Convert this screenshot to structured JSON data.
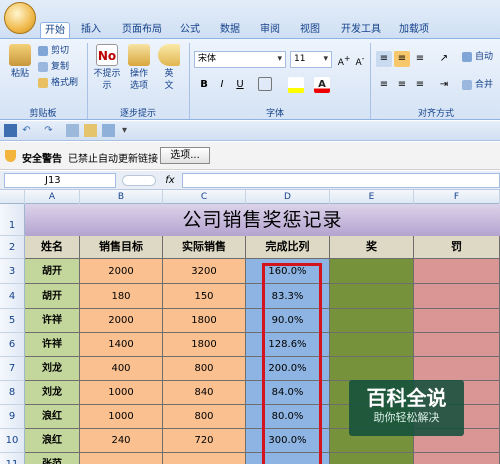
{
  "tabs": [
    "开始",
    "插入",
    "页面布局",
    "公式",
    "数据",
    "审阅",
    "视图",
    "开发工具",
    "加载项"
  ],
  "ribbon": {
    "clipboard": {
      "paste": "粘贴",
      "cut": "剪切",
      "copy": "复制",
      "format_painter": "格式刷",
      "label": "剪贴板"
    },
    "tips": {
      "no_tip": "不提示",
      "no_tip2": "示",
      "ops": "操作",
      "ops2": "选项",
      "en": "英",
      "en2": "文",
      "label": "逐步提示"
    },
    "font": {
      "name": "宋体",
      "size": "11",
      "label": "字体",
      "bold": "B",
      "italic": "I",
      "underline": "U"
    },
    "align": {
      "label": "对齐方式",
      "wrap": "自动",
      "merge": "合并"
    }
  },
  "qat": {
    "items": [
      "save-icon",
      "undo-icon",
      "redo-icon",
      "print-preview-icon",
      "email-icon",
      "customize-icon"
    ]
  },
  "msgbar": {
    "warning": "安全警告",
    "text": "已禁止自动更新链接",
    "button": "选项..."
  },
  "formula_bar": {
    "cell": "J13",
    "fx": "fx",
    "formula": ""
  },
  "columns": [
    "A",
    "B",
    "C",
    "D",
    "E",
    "F"
  ],
  "rows": [
    "1",
    "2",
    "3",
    "4",
    "5",
    "6",
    "7",
    "8",
    "9",
    "10",
    "11"
  ],
  "sheet": {
    "title": "公司销售奖惩记录",
    "headers": [
      "姓名",
      "销售目标",
      "实际销售",
      "完成比列",
      "奖",
      "罚"
    ],
    "data": [
      [
        "胡开",
        "2000",
        "3200",
        "160.0%"
      ],
      [
        "胡开",
        "180",
        "150",
        "83.3%"
      ],
      [
        "许祥",
        "2000",
        "1800",
        "90.0%"
      ],
      [
        "许祥",
        "1400",
        "1800",
        "128.6%"
      ],
      [
        "刘龙",
        "400",
        "800",
        "200.0%"
      ],
      [
        "刘龙",
        "1000",
        "840",
        "84.0%"
      ],
      [
        "浪红",
        "1000",
        "800",
        "80.0%"
      ],
      [
        "浪红",
        "240",
        "720",
        "300.0%"
      ],
      [
        "张范",
        "",
        "",
        ""
      ]
    ]
  },
  "watermark": {
    "title": "百科全说",
    "subtitle": "助你轻松解决"
  },
  "colors": {
    "name_col": "#c3d69b",
    "b_col": "#fac090",
    "c_col": "#fac090",
    "d_col": "#8db4e2",
    "e_col": "#76933c",
    "f_col": "#da9694"
  }
}
